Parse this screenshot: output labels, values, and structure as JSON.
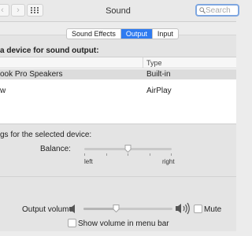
{
  "window": {
    "title": "Sound"
  },
  "search": {
    "placeholder": "Search"
  },
  "tabs": [
    {
      "label": "Sound Effects",
      "active": false
    },
    {
      "label": "Output",
      "active": true
    },
    {
      "label": "Input",
      "active": false
    }
  ],
  "output": {
    "heading": "a device for sound output:",
    "columns": {
      "name": "",
      "type": "Type"
    },
    "devices": [
      {
        "name": "ook Pro Speakers",
        "type": "Built-in",
        "selected": true
      },
      {
        "name": "w",
        "type": "AirPlay",
        "selected": false
      }
    ],
    "settings_label": "gs for the selected device:",
    "balance": {
      "label": "Balance:",
      "left_label": "left",
      "right_label": "right",
      "value": 0.5
    }
  },
  "volume": {
    "label": "Output volume:",
    "value": 0.37,
    "mute_label": "Mute",
    "mute_checked": false,
    "show_in_menu_bar_label": "Show volume in menu bar",
    "show_in_menu_bar_checked": false
  },
  "colors": {
    "accent": "#2f7bf0",
    "search_focus": "#7ea6e0",
    "selected_row": "#dcdcdc"
  },
  "icons": [
    "back-icon",
    "forward-icon",
    "grid-icon",
    "search-icon",
    "speaker-low-icon",
    "speaker-high-icon"
  ]
}
